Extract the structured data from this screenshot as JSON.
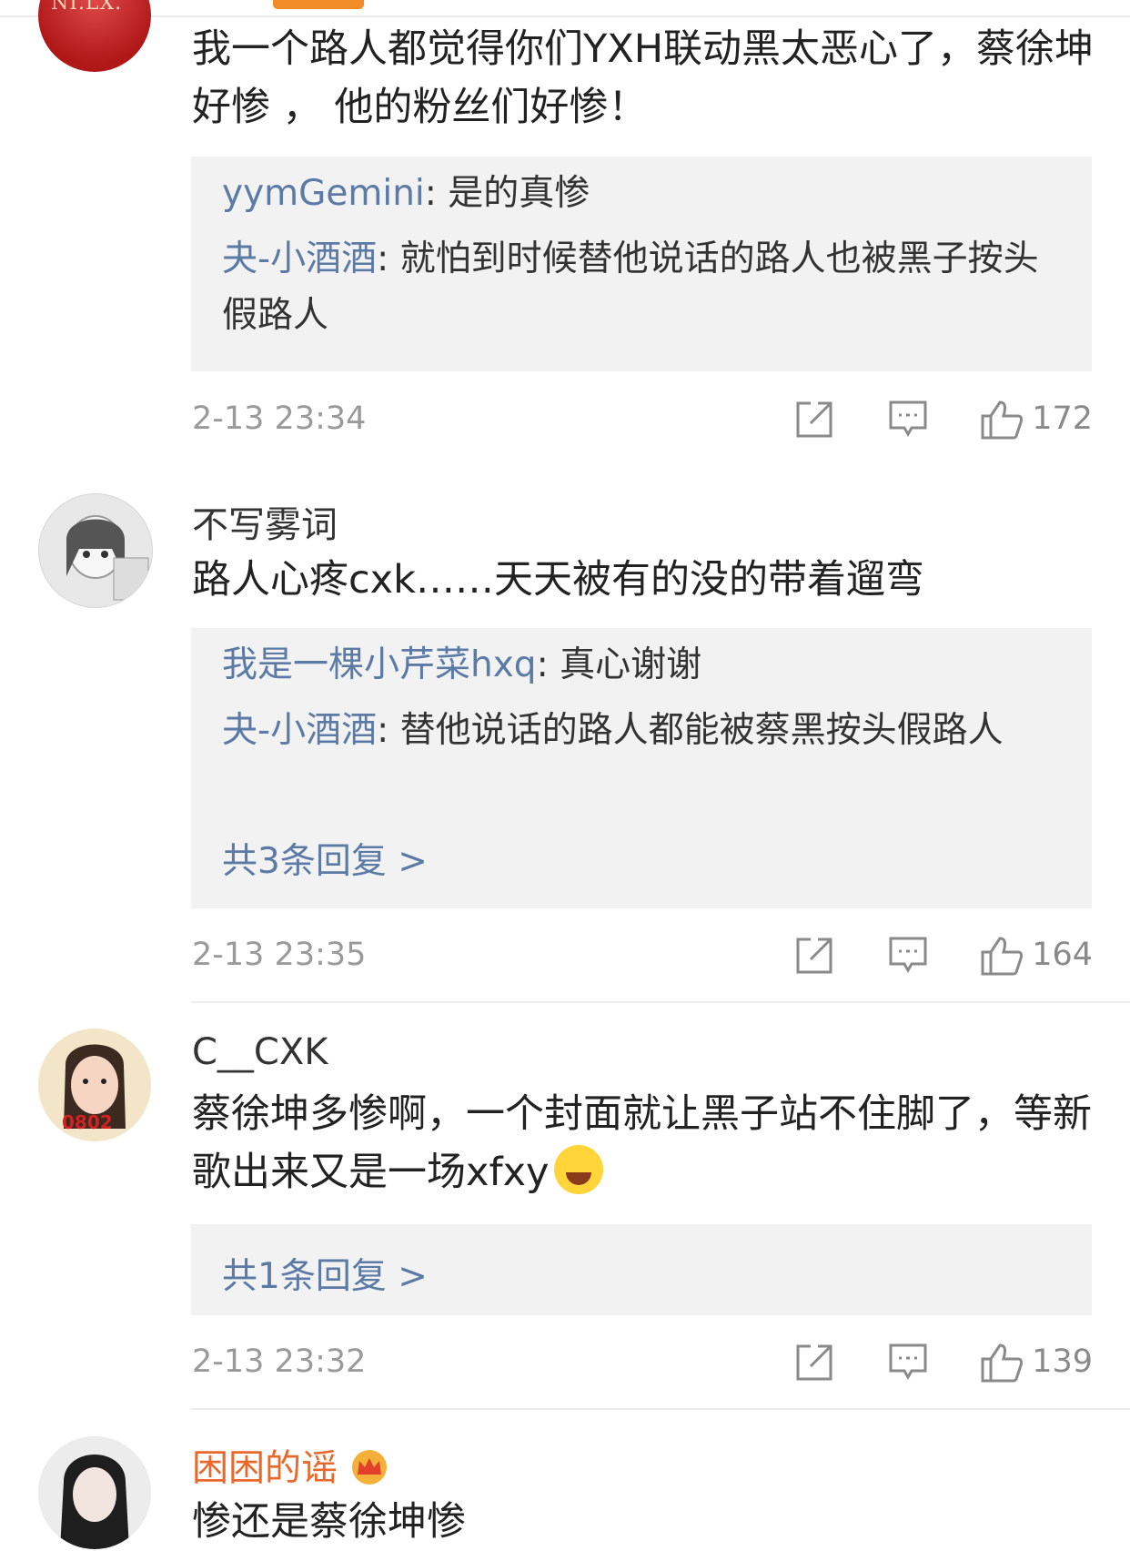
{
  "comments": [
    {
      "avatar_text": "NI.LX.",
      "username": "",
      "text": "我一个路人都觉得你们YXH联动黑太恶心了，蔡徐坤好惨 ， 他的粉丝们好惨！",
      "replies": [
        {
          "name": "yymGemini",
          "text": ": 是的真惨"
        },
        {
          "name": "夬-小酒酒",
          "text": ": 就怕到时候替他说话的路人也被黑子按头假路人"
        }
      ],
      "more": "",
      "time": "2-13 23:34",
      "likes": "172"
    },
    {
      "username": "不写雾词",
      "text": "路人心疼cxk……天天被有的没的带着遛弯",
      "replies": [
        {
          "name": "我是一棵小芹菜hxq",
          "text": ": 真心谢谢"
        },
        {
          "name": "夬-小酒酒",
          "text": ": 替他说话的路人都能被蔡黑按头假路人"
        }
      ],
      "more": "共3条回复 >",
      "time": "2-13 23:35",
      "likes": "164"
    },
    {
      "avatar_text": "0802",
      "username": "C__CXK",
      "text": "蔡徐坤多惨啊，一个封面就让黑子站不住脚了，等新歌出来又是一场xfxy",
      "replies": [],
      "more": "共1条回复 >",
      "time": "2-13 23:32",
      "likes": "139"
    },
    {
      "username": "困困的谣",
      "text": "惨还是蔡徐坤惨"
    }
  ],
  "icons": {
    "share": "share-icon",
    "comment": "comment-icon",
    "like": "thumbs-up-icon",
    "crown": "crown-icon",
    "emoji_laugh": "laughing-emoji-icon"
  },
  "colors": {
    "accent": "#f28c28",
    "link": "#5b7aa6",
    "vip_name": "#e8692b"
  }
}
